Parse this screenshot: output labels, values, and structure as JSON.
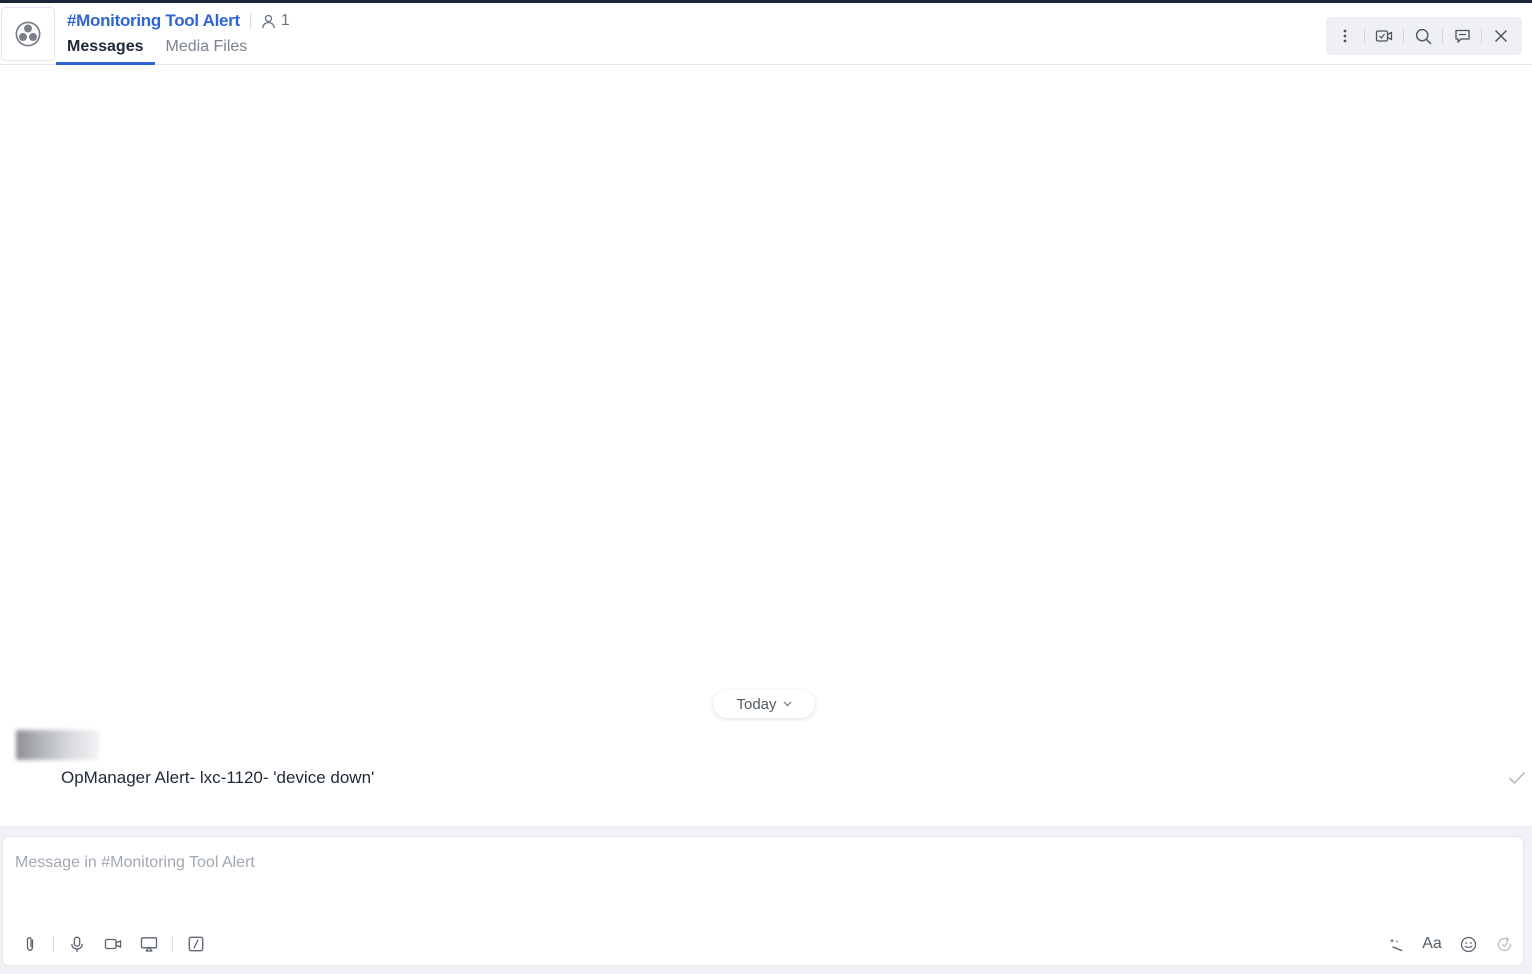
{
  "header": {
    "channel_title": "#Monitoring Tool Alert",
    "member_count": "1",
    "tabs": [
      {
        "label": "Messages",
        "active": true
      },
      {
        "label": "Media Files",
        "active": false
      }
    ],
    "toolbar_icons": [
      "more-vertical-icon",
      "video-meeting-icon",
      "search-icon",
      "chat-thread-icon",
      "close-icon"
    ]
  },
  "conversation": {
    "date_separator": "Today",
    "messages": [
      {
        "text": "OpManager Alert-  lxc-1120- 'device down'",
        "status": "delivered"
      }
    ]
  },
  "composer": {
    "placeholder": "Message in #Monitoring Tool Alert",
    "value": "",
    "format_label": "Aa"
  },
  "colors": {
    "accent": "#2f64d6",
    "toolbar_bg": "#eef0f3",
    "composer_bg": "#f0f2f5",
    "top_strip": "#1b2636"
  }
}
